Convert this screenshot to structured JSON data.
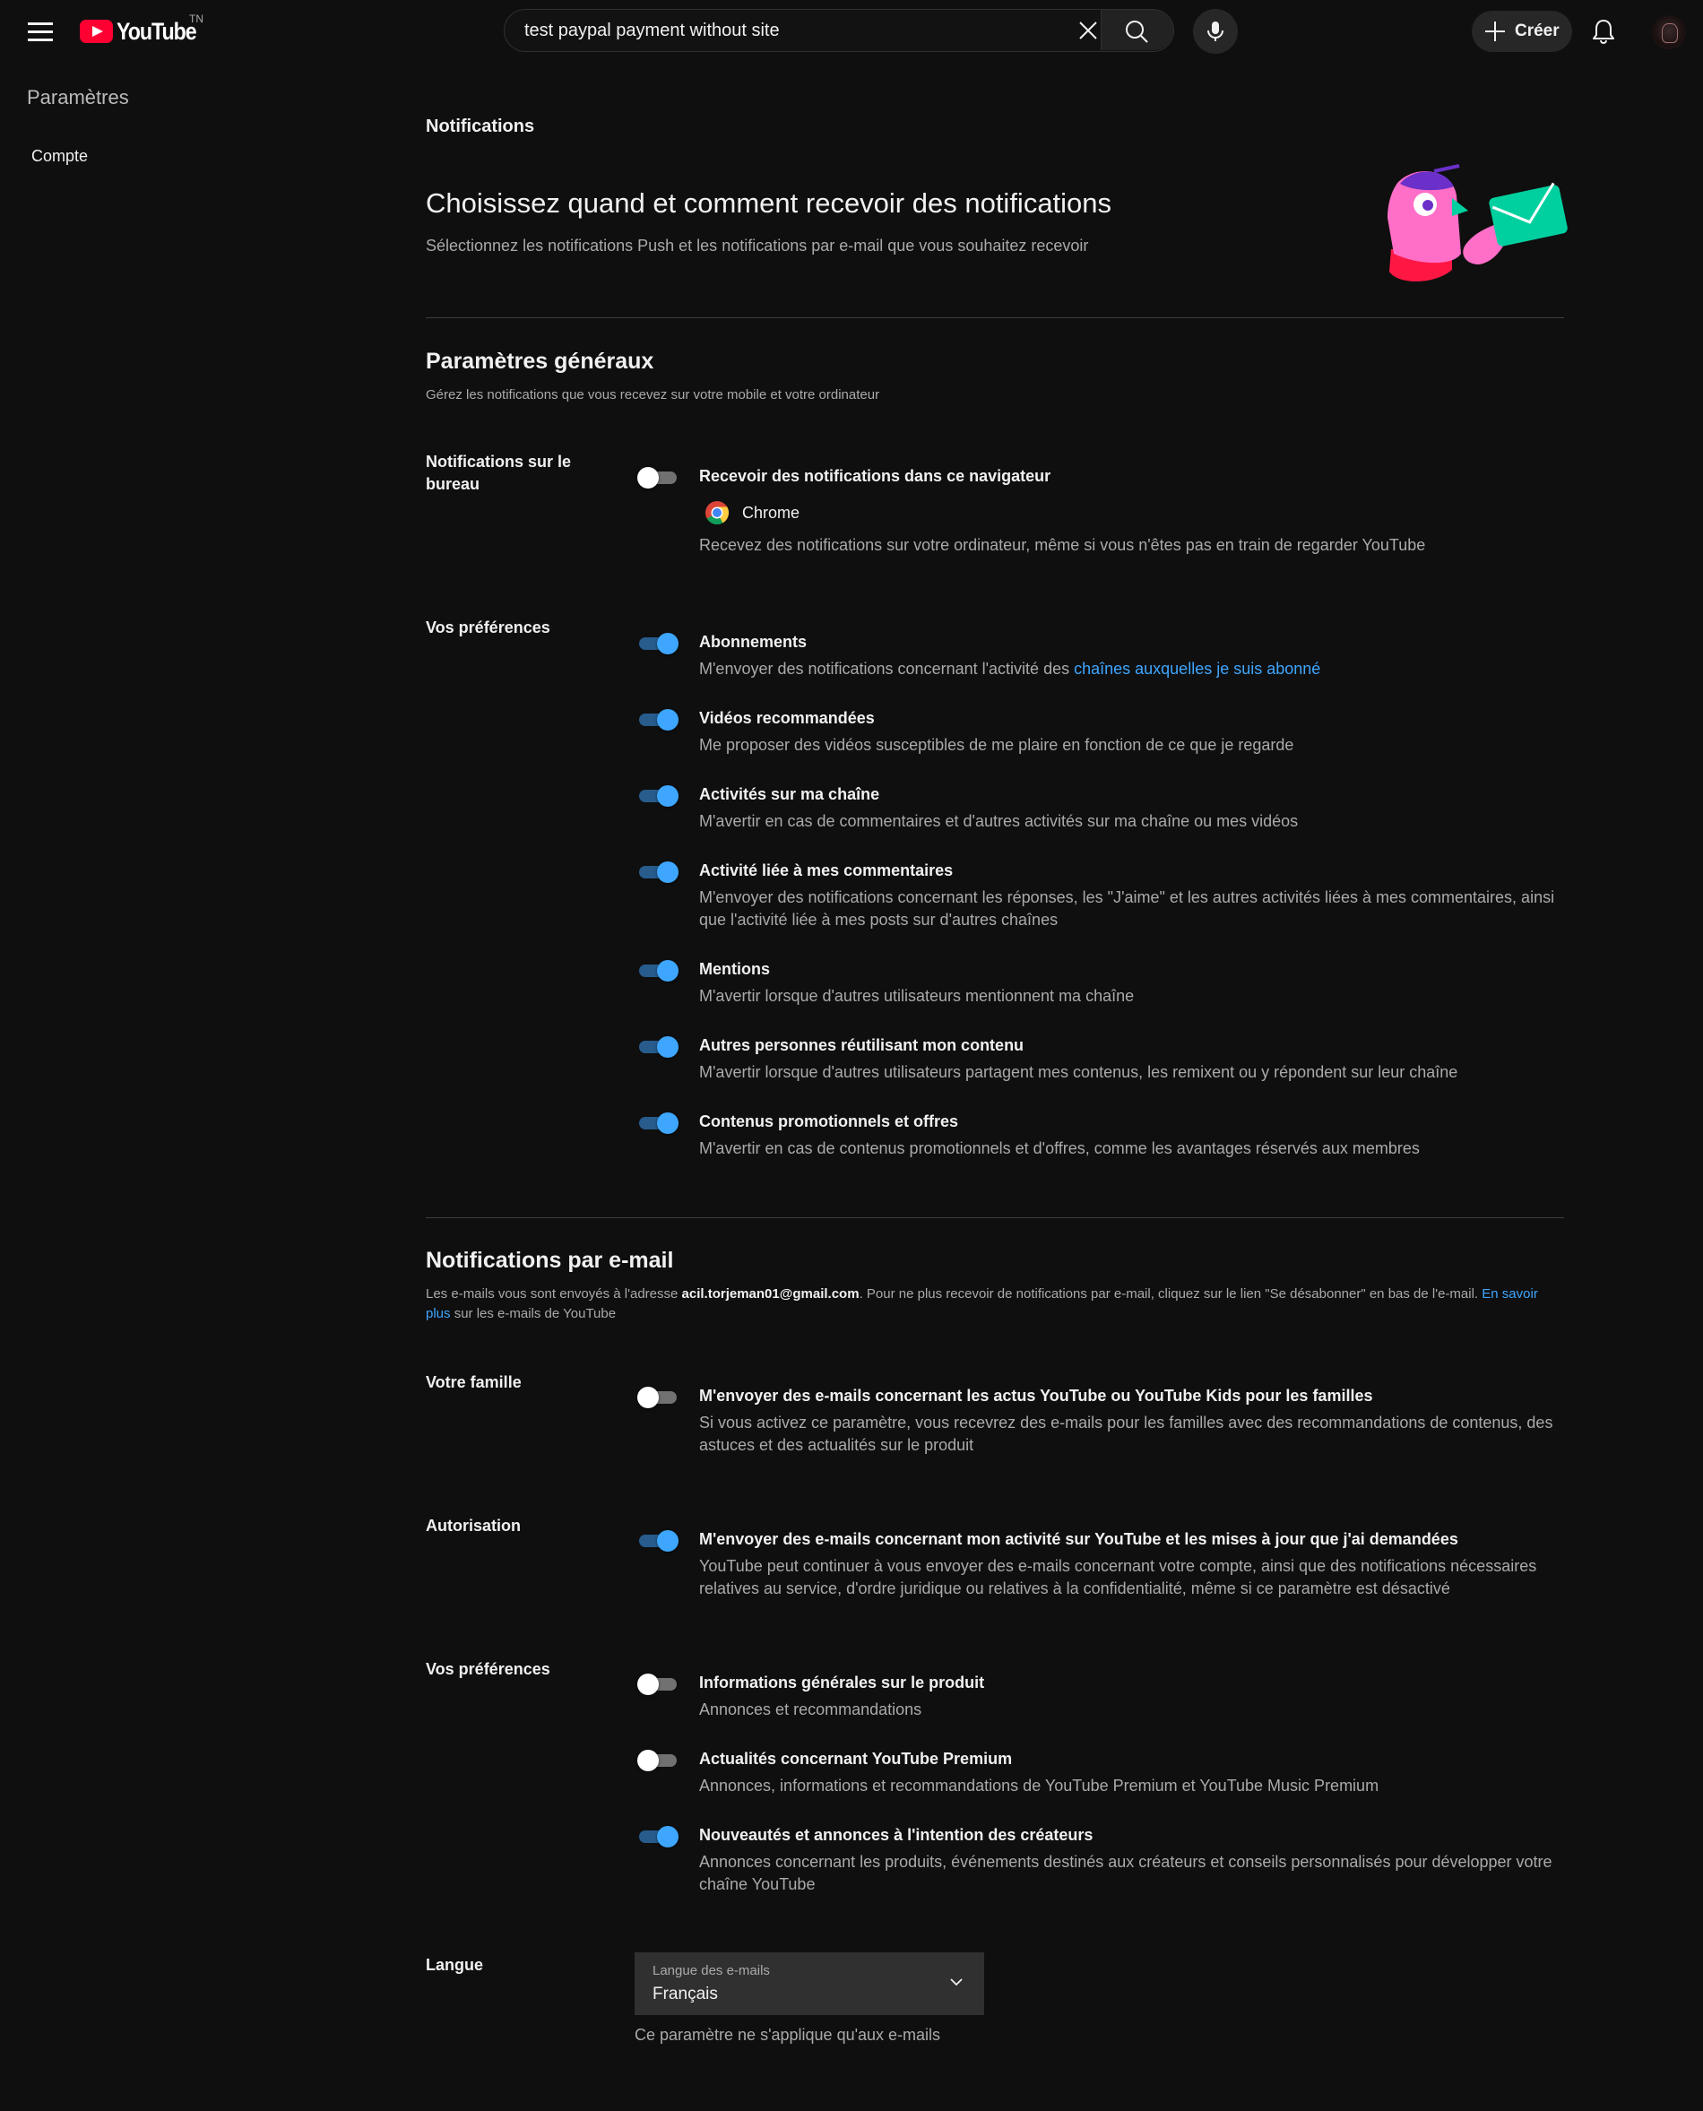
{
  "header": {
    "logo_text": "YouTube",
    "country_code": "TN",
    "search_value": "test paypal payment without site",
    "create_label": "Créer"
  },
  "sidebar": {
    "title": "Paramètres",
    "items": [
      {
        "label": "Compte"
      }
    ]
  },
  "page": {
    "label": "Notifications",
    "title": "Choisissez quand et comment recevoir des notifications",
    "subtitle": "Sélectionnez les notifications Push et les notifications par e-mail que vous souhaitez recevoir"
  },
  "general": {
    "title": "Paramètres généraux",
    "subtitle": "Gérez les notifications que vous recevez sur votre mobile et votre ordinateur",
    "desktop_label": "Notifications sur le bureau",
    "desktop_option": {
      "title": "Recevoir des notifications dans ce navigateur",
      "browser": "Chrome",
      "desc": "Recevez des notifications sur votre ordinateur, même si vous n'êtes pas en train de regarder YouTube",
      "enabled": false
    },
    "prefs_label": "Vos préférences",
    "prefs": [
      {
        "title": "Abonnements",
        "desc_prefix": "M'envoyer des notifications concernant l'activité des ",
        "desc_link": "chaînes auxquelles je suis abonné",
        "enabled": true
      },
      {
        "title": "Vidéos recommandées",
        "desc": "Me proposer des vidéos susceptibles de me plaire en fonction de ce que je regarde",
        "enabled": true
      },
      {
        "title": "Activités sur ma chaîne",
        "desc": "M'avertir en cas de commentaires et d'autres activités sur ma chaîne ou mes vidéos",
        "enabled": true
      },
      {
        "title": "Activité liée à mes commentaires",
        "desc": "M'envoyer des notifications concernant les réponses, les \"J'aime\" et les autres activités liées à mes commentaires, ainsi que l'activité liée à mes posts sur d'autres chaînes",
        "enabled": true
      },
      {
        "title": "Mentions",
        "desc": "M'avertir lorsque d'autres utilisateurs mentionnent ma chaîne",
        "enabled": true
      },
      {
        "title": "Autres personnes réutilisant mon contenu",
        "desc": "M'avertir lorsque d'autres utilisateurs partagent mes contenus, les remixent ou y répondent sur leur chaîne",
        "enabled": true
      },
      {
        "title": "Contenus promotionnels et offres",
        "desc": "M'avertir en cas de contenus promotionnels et d'offres, comme les avantages réservés aux membres",
        "enabled": true
      }
    ]
  },
  "email": {
    "title": "Notifications par e-mail",
    "sub_prefix": "Les e-mails vous sont envoyés à l'adresse ",
    "address": "acil.torjeman01@gmail.com",
    "sub_middle": ". Pour ne plus recevoir de notifications par e-mail, cliquez sur le lien \"Se désabonner\" en bas de l'e-mail. ",
    "sub_link": "En savoir plus",
    "sub_suffix": " sur les e-mails de YouTube",
    "family_label": "Votre famille",
    "family_option": {
      "title": "M'envoyer des e-mails concernant les actus YouTube ou YouTube Kids pour les familles",
      "desc": "Si vous activez ce paramètre, vous recevrez des e-mails pour les familles avec des recommandations de contenus, des astuces et des actualités sur le produit",
      "enabled": false
    },
    "auth_label": "Autorisation",
    "auth_option": {
      "title": "M'envoyer des e-mails concernant mon activité sur YouTube et les mises à jour que j'ai demandées",
      "desc": "YouTube peut continuer à vous envoyer des e-mails concernant votre compte, ainsi que des notifications nécessaires relatives au service, d'ordre juridique ou relatives à la confidentialité, même si ce paramètre est désactivé",
      "enabled": true
    },
    "prefs_label": "Vos préférences",
    "prefs": [
      {
        "title": "Informations générales sur le produit",
        "desc": "Annonces et recommandations",
        "enabled": false
      },
      {
        "title": "Actualités concernant YouTube Premium",
        "desc": "Annonces, informations et recommandations de YouTube Premium et YouTube Music Premium",
        "enabled": false
      },
      {
        "title": "Nouveautés et annonces à l'intention des créateurs",
        "desc": "Annonces concernant les produits, événements destinés aux créateurs et conseils personnalisés pour développer votre chaîne YouTube",
        "enabled": true
      }
    ],
    "language_label": "Langue",
    "language_select_label": "Langue des e-mails",
    "language_value": "Français",
    "language_note": "Ce paramètre ne s'applique qu'aux e-mails"
  },
  "colors": {
    "accent": "#3ea6ff",
    "brand_red": "#ff0033",
    "background": "#0f0f0f"
  },
  "icons": [
    "menu-icon",
    "youtube-logo",
    "clear-icon",
    "search-icon",
    "mic-icon",
    "plus-icon",
    "bell-icon",
    "chrome-icon",
    "chevron-down-icon"
  ]
}
